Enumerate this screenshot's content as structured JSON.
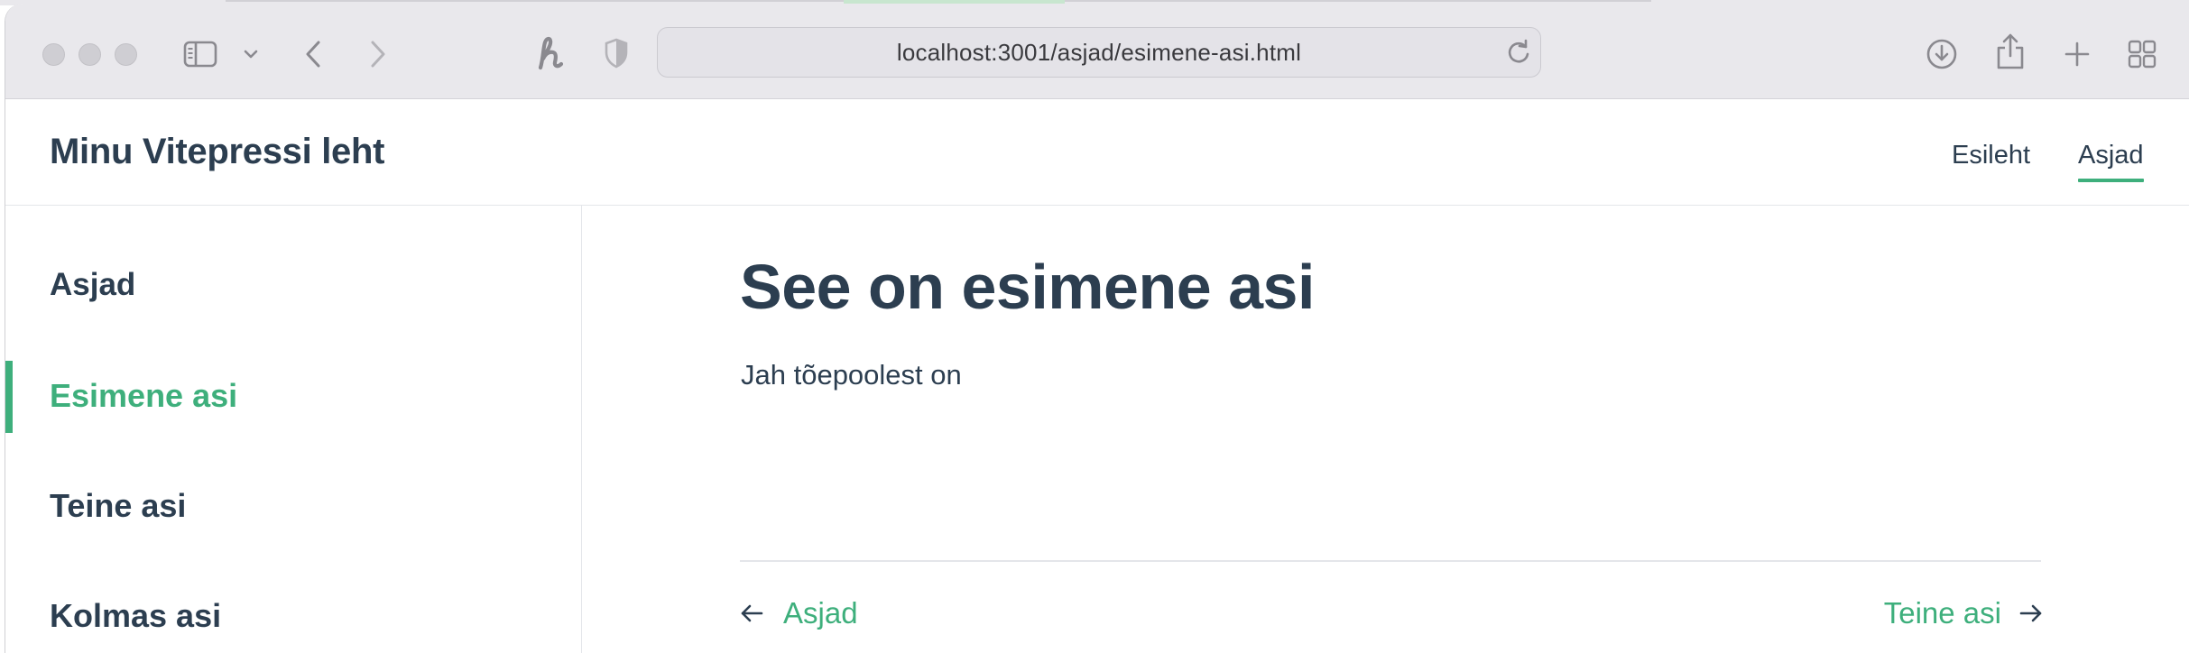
{
  "browser": {
    "url": "localhost:3001/asjad/esimene-asi.html"
  },
  "site": {
    "title": "Minu Vitepressi leht",
    "nav": [
      {
        "label": "Esileht",
        "active": false
      },
      {
        "label": "Asjad",
        "active": true
      }
    ],
    "accent_color": "#3eaf7c",
    "text_color": "#2c3e50"
  },
  "sidebar": {
    "heading": "Asjad",
    "items": [
      {
        "label": "Esimene asi",
        "active": true
      },
      {
        "label": "Teine asi",
        "active": false
      },
      {
        "label": "Kolmas asi",
        "active": false
      }
    ]
  },
  "page": {
    "title": "See on esimene asi",
    "body": "Jah tõepoolest on"
  },
  "pagination": {
    "prev_label": "Asjad",
    "next_label": "Teine asi"
  },
  "icons": {
    "toolbar": [
      "sidebar-toggle-icon",
      "chevron-down-icon",
      "back-icon",
      "forward-icon",
      "honey-extension-icon",
      "privacy-shield-icon",
      "reload-icon",
      "download-icon",
      "share-icon",
      "new-tab-icon",
      "tab-overview-icon"
    ],
    "pagination": [
      "arrow-left-icon",
      "arrow-right-icon"
    ]
  }
}
